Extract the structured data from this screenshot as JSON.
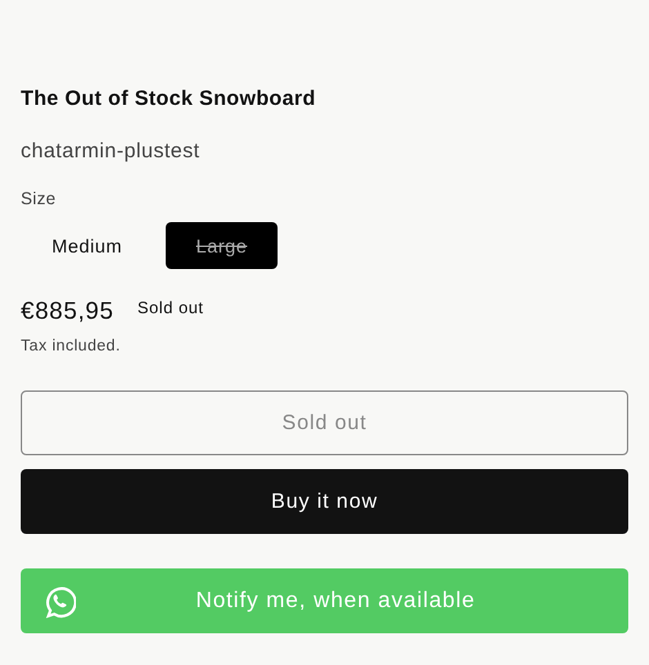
{
  "product": {
    "title": "The Out of Stock Snowboard",
    "vendor": "chatarmin-plustest"
  },
  "size": {
    "label": "Size",
    "options": [
      {
        "label": "Medium",
        "selected": false,
        "available": true
      },
      {
        "label": "Large",
        "selected": true,
        "available": false
      }
    ]
  },
  "price": {
    "amount": "€885,95",
    "badge": "Sold out",
    "tax_note": "Tax included."
  },
  "buttons": [
    {
      "kind": "outline",
      "label": "Sold out",
      "disabled": true
    },
    {
      "kind": "dark",
      "label": "Buy it now",
      "disabled": false
    },
    {
      "kind": "whatsapp",
      "label": "Notify me, when available",
      "disabled": false
    }
  ]
}
